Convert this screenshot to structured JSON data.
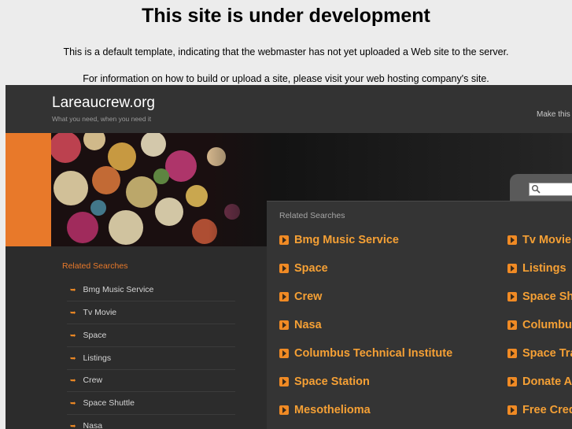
{
  "notice": {
    "title": "This site is under development",
    "line1": "This is a default template, indicating that the webmaster has not yet uploaded a Web site to the server.",
    "line2": "For information on how to build or upload a site, please visit your web hosting company's site."
  },
  "header": {
    "site_name": "Lareaucrew.org",
    "tagline": "What you need, when you need it",
    "make_link": "Make this"
  },
  "colors": {
    "accent_orange": "#e8792a",
    "link_orange": "#f5a035",
    "background_dark": "#2c2c2c"
  },
  "left_sidebar": {
    "heading": "Related Searches",
    "items": [
      "Bmg Music Service",
      "Tv Movie",
      "Space",
      "Listings",
      "Crew",
      "Space Shuttle",
      "Nasa"
    ]
  },
  "main_panel": {
    "heading": "Related Searches",
    "col1": [
      "Bmg Music Service",
      "Space",
      "Crew",
      "Nasa",
      "Columbus Technical Institute",
      "Space Station",
      "Mesothelioma"
    ],
    "col2": [
      "Tv Movie",
      "Listings",
      "Space Sh",
      "Columbu",
      "Space Tra",
      "Donate A",
      "Free Cred"
    ]
  }
}
